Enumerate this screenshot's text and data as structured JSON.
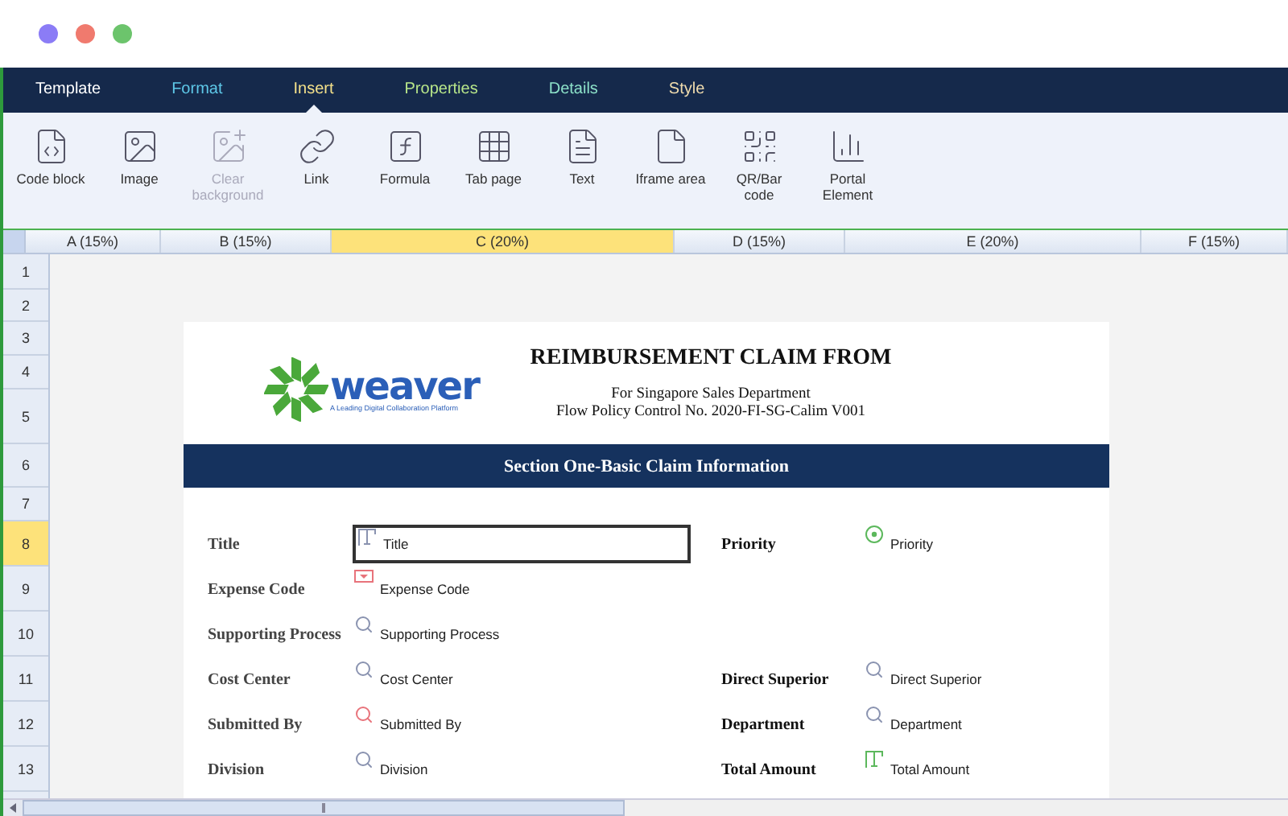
{
  "tabs": [
    {
      "label": "Template",
      "selected": false
    },
    {
      "label": "Format",
      "selected": false
    },
    {
      "label": "Insert",
      "selected": true
    },
    {
      "label": "Properties",
      "selected": false
    },
    {
      "label": "Details",
      "selected": false
    },
    {
      "label": "Style",
      "selected": false
    }
  ],
  "toolbar": [
    {
      "label": "Code block",
      "disabled": false
    },
    {
      "label": "Image",
      "disabled": false
    },
    {
      "label": "Clear background",
      "disabled": true
    },
    {
      "label": "Link",
      "disabled": false
    },
    {
      "label": "Formula",
      "disabled": false
    },
    {
      "label": "Tab page",
      "disabled": false
    },
    {
      "label": "Text",
      "disabled": false
    },
    {
      "label": "Iframe area",
      "disabled": false
    },
    {
      "label": "QR/Bar code",
      "disabled": false
    },
    {
      "label": "Portal Element",
      "disabled": false
    }
  ],
  "columns": [
    {
      "label": "A (15%)",
      "selected": false
    },
    {
      "label": "B (15%)",
      "selected": false
    },
    {
      "label": "C (20%)",
      "selected": true
    },
    {
      "label": "D (15%)",
      "selected": false
    },
    {
      "label": "E (20%)",
      "selected": false
    },
    {
      "label": "F (15%)",
      "selected": false
    }
  ],
  "rows": [
    {
      "label": "1",
      "selected": false
    },
    {
      "label": "2",
      "selected": false
    },
    {
      "label": "3",
      "selected": false
    },
    {
      "label": "4",
      "selected": false
    },
    {
      "label": "5",
      "selected": false
    },
    {
      "label": "6",
      "selected": false
    },
    {
      "label": "7",
      "selected": false
    },
    {
      "label": "8",
      "selected": true
    },
    {
      "label": "9",
      "selected": false
    },
    {
      "label": "10",
      "selected": false
    },
    {
      "label": "11",
      "selected": false
    },
    {
      "label": "12",
      "selected": false
    },
    {
      "label": "13",
      "selected": false
    }
  ],
  "form": {
    "logo": {
      "name": "weaver",
      "tagline": "A Leading Digital Collaboration Platform"
    },
    "title": "REIMBURSEMENT CLAIM FROM",
    "subtitle": "For Singapore Sales Department",
    "policy": "Flow Policy Control No. 2020-FI-SG-Calim V001",
    "section": "Section One-Basic Claim Information",
    "field_rows": [
      {
        "left": {
          "label": "Title",
          "kind": "text",
          "color": "#8a93b0",
          "value": "Title",
          "selected": true
        },
        "right": {
          "label": "Priority",
          "kind": "radio",
          "color": "#5cb85c",
          "value": "Priority",
          "selected": false
        }
      },
      {
        "left": {
          "label": "Expense Code",
          "kind": "dropdown",
          "color": "#e8737b",
          "value": "Expense Code",
          "selected": false
        }
      },
      {
        "left": {
          "label": "Supporting Process",
          "kind": "browse",
          "color": "#8a93b0",
          "value": "Supporting Process",
          "selected": false
        }
      },
      {
        "left": {
          "label": "Cost Center",
          "kind": "browse",
          "color": "#8a93b0",
          "value": "Cost Center",
          "selected": false
        },
        "right": {
          "label": "Direct Superior",
          "kind": "browse",
          "color": "#8a93b0",
          "value": "Direct Superior",
          "selected": false
        }
      },
      {
        "left": {
          "label": "Submitted By",
          "kind": "browse",
          "color": "#e8737b",
          "value": "Submitted By",
          "selected": false
        },
        "right": {
          "label": "Department",
          "kind": "browse",
          "color": "#8a93b0",
          "value": "Department",
          "selected": false
        }
      },
      {
        "left": {
          "label": "Division",
          "kind": "browse",
          "color": "#8a93b0",
          "value": "Division",
          "selected": false
        },
        "right": {
          "label": "Total Amount",
          "kind": "text",
          "color": "#5cb85c",
          "value": "Total Amount",
          "selected": false
        }
      }
    ]
  }
}
